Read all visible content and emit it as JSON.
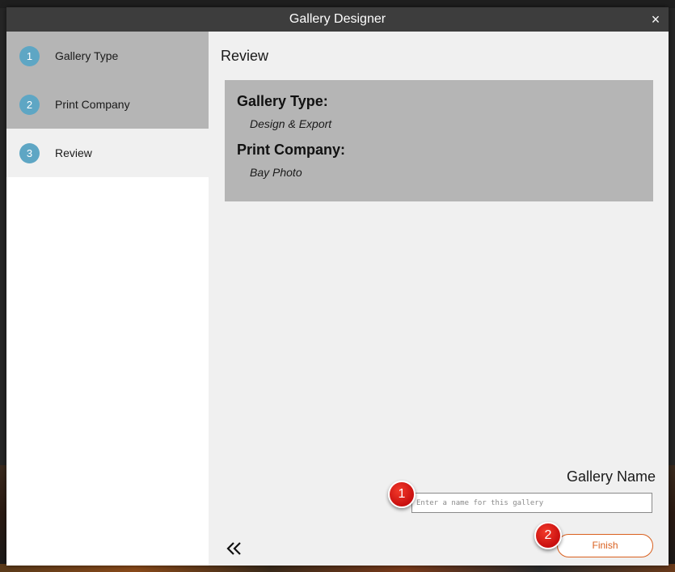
{
  "dialog": {
    "title": "Gallery Designer",
    "close_icon": "×"
  },
  "steps": [
    {
      "number": "1",
      "label": "Gallery Type",
      "active": false
    },
    {
      "number": "2",
      "label": "Print Company",
      "active": false
    },
    {
      "number": "3",
      "label": "Review",
      "active": true
    }
  ],
  "main": {
    "title": "Review",
    "summary": {
      "gallery_type_label": "Gallery Type:",
      "gallery_type_value": "Design & Export",
      "print_company_label": "Print Company:",
      "print_company_value": "Bay Photo"
    },
    "gallery_name_label": "Gallery Name",
    "gallery_name_placeholder": "Enter a name for this gallery",
    "gallery_name_value": "",
    "finish_label": "Finish",
    "back_icon": "double-chevron-left-icon"
  },
  "annotations": [
    {
      "number": "1"
    },
    {
      "number": "2"
    }
  ],
  "colors": {
    "accent_orange": "#d9601f",
    "step_circle": "#5ea6c4",
    "marker_red": "#d9161a"
  }
}
